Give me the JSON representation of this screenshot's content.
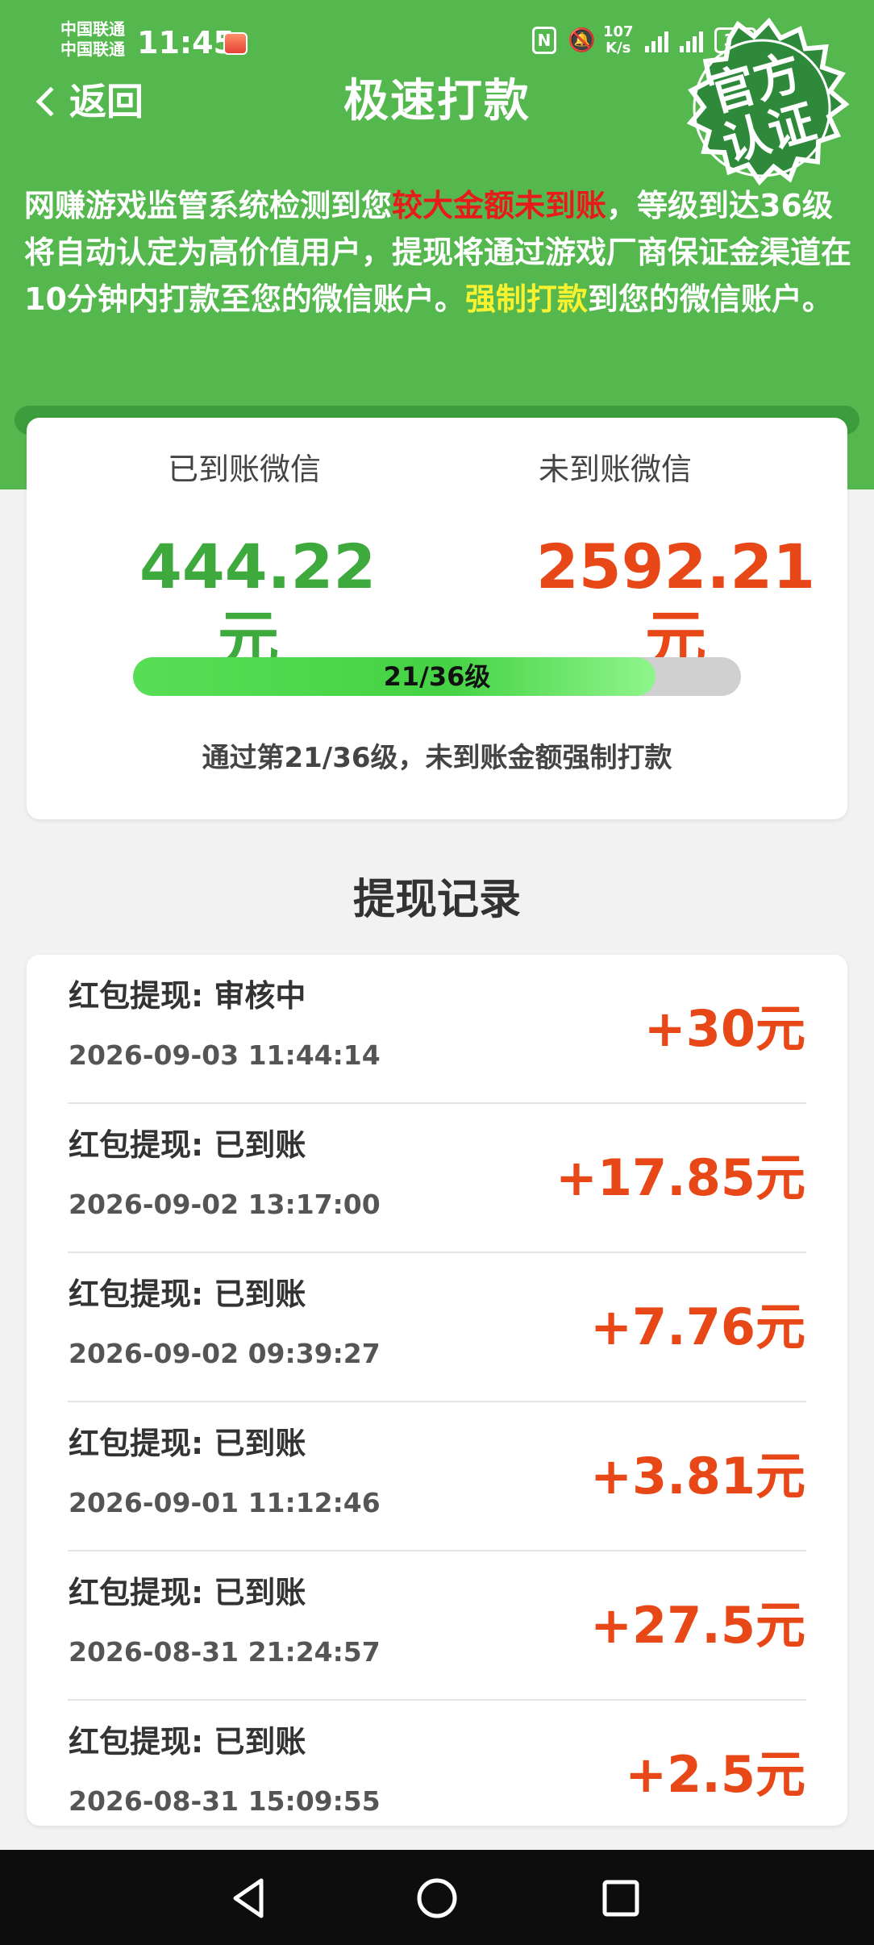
{
  "status_bar": {
    "carrier_1": "中国联通",
    "carrier_2": "中国联通",
    "time": "11:45",
    "net_speed_value": "107",
    "net_speed_unit": "K/s",
    "battery": "39"
  },
  "header": {
    "back_label": "返回",
    "title": "极速打款",
    "badge_line1": "官方",
    "badge_line2": "认证"
  },
  "notice": {
    "part1": "网赚游戏监管系统检测到您",
    "highlight_red": "较大金额未到账",
    "part2": "，等级到达36级将自动认定为高价值用户，提现将通过游戏厂商保证金渠道在10分钟内打款至您的微信账户。",
    "highlight_yellow": "强制打款",
    "part3": "到您的微信账户。"
  },
  "summary": {
    "received_label": "已到账微信",
    "received_amount": "444.22元",
    "pending_label": "未到账微信",
    "pending_amount": "2592.21元",
    "progress_text": "21/36级",
    "progress_fraction": 0.86,
    "note": "通过第21/36级，未到账金额强制打款"
  },
  "records_title": "提现记录",
  "records": [
    {
      "title": "红包提现: 审核中",
      "time": "2026-09-03 11:44:14",
      "amount": "+30元"
    },
    {
      "title": "红包提现: 已到账",
      "time": "2026-09-02 13:17:00",
      "amount": "+17.85元"
    },
    {
      "title": "红包提现: 已到账",
      "time": "2026-09-02 09:39:27",
      "amount": "+7.76元"
    },
    {
      "title": "红包提现: 已到账",
      "time": "2026-09-01 11:12:46",
      "amount": "+3.81元"
    },
    {
      "title": "红包提现: 已到账",
      "time": "2026-08-31 21:24:57",
      "amount": "+27.5元"
    },
    {
      "title": "红包提现: 已到账",
      "time": "2026-08-31 15:09:55",
      "amount": "+2.5元"
    }
  ],
  "colors": {
    "header_green": "#55b84f",
    "received_green": "#3ea93c",
    "amount_red": "#e84817",
    "notice_red": "#e81b1b",
    "notice_yellow": "#f8f230"
  },
  "icons": [
    "back-icon",
    "nfc-icon",
    "mute-icon",
    "signal-icon",
    "battery-icon",
    "nav-back-icon",
    "nav-home-icon",
    "nav-recent-icon"
  ]
}
